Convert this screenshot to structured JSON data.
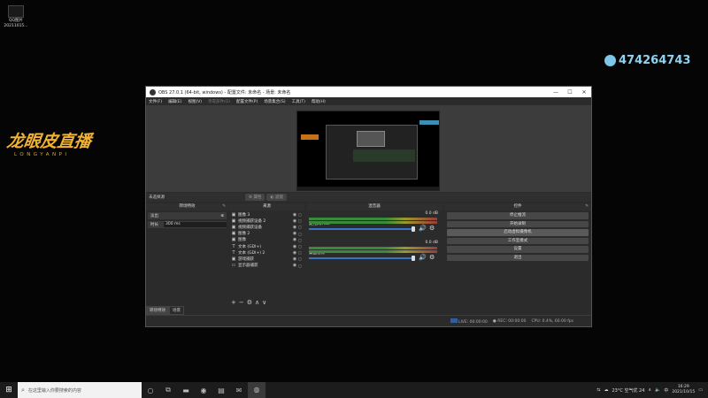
{
  "desktop": {
    "icon_label_1": "QQ图片",
    "icon_label_2": "20211015...",
    "brand_cn": "龙眼皮直播",
    "brand_en": "LONGYANPI",
    "qq_number": "474264743"
  },
  "window": {
    "title": "OBS 27.0.1 (64-bit, windows) - 配置文件: 未命名 - 场景: 未命名",
    "minimize": "—",
    "maximize": "☐",
    "close": "✕"
  },
  "menu": {
    "items": [
      "文件(F)",
      "编辑(E)",
      "视图(V)",
      "停靠部件(D)",
      "配置文件(P)",
      "场景集合(S)",
      "工具(T)",
      "帮助(H)"
    ]
  },
  "scene_bar": {
    "label": "未选择源",
    "properties": "属性",
    "filters": "滤镜"
  },
  "docks": {
    "filter_title": "转场特效",
    "sources_title": "来源",
    "mixer_title": "混音器",
    "controls_title": "控件"
  },
  "transition": {
    "type_value": "淡出",
    "duration_label": "时长",
    "duration_value": "300 ms",
    "tabs": [
      "转场特效",
      "场景"
    ]
  },
  "sources": [
    {
      "icon": "▣",
      "name": "图像 3"
    },
    {
      "icon": "▣",
      "name": "视频捕获设备 2"
    },
    {
      "icon": "▣",
      "name": "视频捕获设备"
    },
    {
      "icon": "▣",
      "name": "图像 2"
    },
    {
      "icon": "▣",
      "name": "图像"
    },
    {
      "icon": "T",
      "name": "文本 (GDI+)"
    },
    {
      "icon": "T",
      "name": "文本 (GDI+) 2"
    },
    {
      "icon": "▣",
      "name": "游戏捕获"
    },
    {
      "icon": "▭",
      "name": "显示器捕获"
    }
  ],
  "sources_toolbar": {
    "add": "+",
    "remove": "−",
    "settings": "⚙",
    "up": "∧",
    "down": "∨"
  },
  "mixer": [
    {
      "name": "麦克风/Aux",
      "db": "0.0 dB"
    },
    {
      "name": "桌面音频",
      "db": "0.0 dB"
    }
  ],
  "controls": {
    "buttons": [
      "停止推流",
      "开始录制",
      "启动虚拟摄像机",
      "工作室模式",
      "设置",
      "退出"
    ]
  },
  "status": {
    "live": "LIVE: 00:00:00",
    "rec": "REC: 00:00:00",
    "cpu": "CPU: 0.4%, 60.00 fps"
  },
  "taskbar": {
    "search_placeholder": "在这里输入你要搜索的内容",
    "weather": "23°C 空气优 24",
    "time": "16:29",
    "date": "2021/10/15"
  }
}
